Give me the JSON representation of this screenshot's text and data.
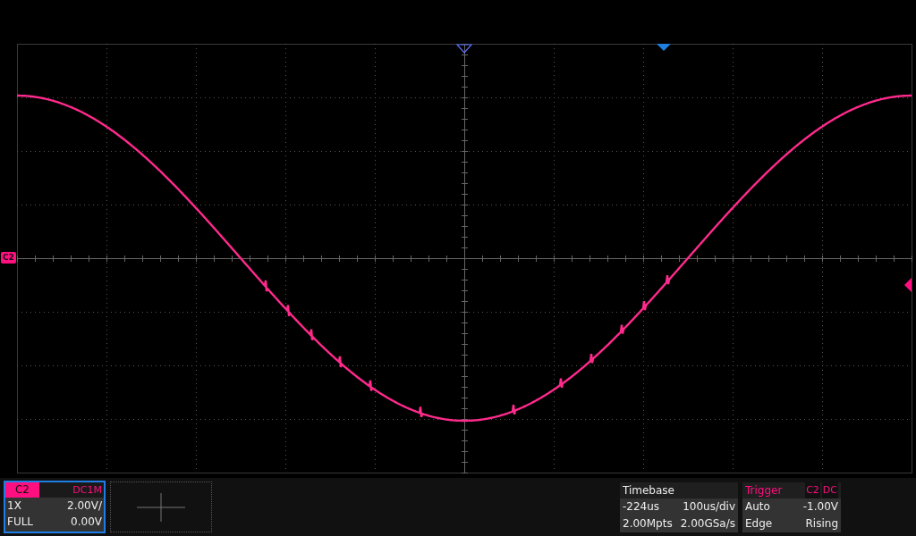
{
  "channel_marker": "C2",
  "channel": {
    "name": "C2",
    "coupling": "DC1M",
    "probe": "1X",
    "scale": "2.00V/",
    "bandwidth": "FULL",
    "offset": "0.00V",
    "selected": true
  },
  "timebase": {
    "title": "Timebase",
    "delay": "-224us",
    "scale": "100us/div",
    "memory": "2.00Mpts",
    "sample_rate": "2.00GSa/s"
  },
  "trigger": {
    "title": "Trigger",
    "source": "C2",
    "coupling": "DC",
    "mode": "Auto",
    "level_reading": "-1.00V",
    "type": "Edge",
    "slope": "Rising"
  }
}
